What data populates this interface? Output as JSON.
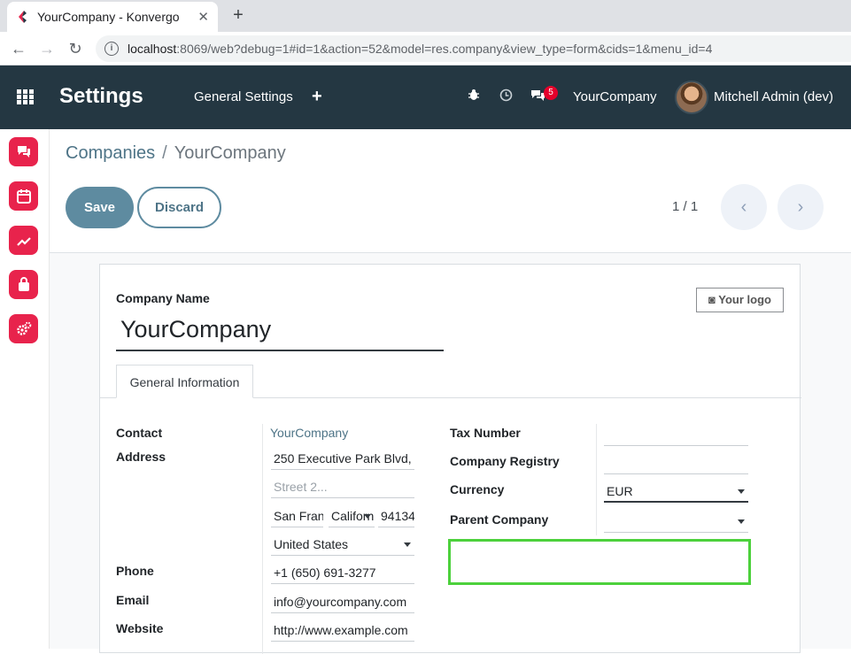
{
  "browser": {
    "tab_title": "YourCompany - Konvergo",
    "url_host": "localhost",
    "url_rest": ":8069/web?debug=1#id=1&action=52&model=res.company&view_type=form&cids=1&menu_id=4"
  },
  "navbar": {
    "app_name": "Settings",
    "menu_general": "General Settings",
    "menu_plus": "+",
    "messages_badge": "5",
    "company": "YourCompany",
    "user": "Mitchell Admin (dev)"
  },
  "rail": {
    "items": [
      "discuss-icon",
      "calendar-icon",
      "dashboard-icon",
      "shopping-bag-icon",
      "settings-gear-icon"
    ]
  },
  "breadcrumb": {
    "parent": "Companies",
    "separator": "/",
    "current": "YourCompany"
  },
  "buttons": {
    "save": "Save",
    "discard": "Discard"
  },
  "pager": {
    "value": "1 / 1"
  },
  "form": {
    "company_name_label": "Company Name",
    "company_name": "YourCompany",
    "logo_button": "Your logo",
    "tab_general": "General Information",
    "left": {
      "contact_label": "Contact",
      "contact_value": "YourCompany",
      "address_label": "Address",
      "street": "250 Executive Park Blvd,",
      "street2_placeholder": "Street 2...",
      "city": "San Francisco",
      "state": "California",
      "zip": "94134",
      "country": "United States",
      "phone_label": "Phone",
      "phone": "+1 (650) 691-3277",
      "email_label": "Email",
      "email": "info@yourcompany.com",
      "website_label": "Website",
      "website": "http://www.example.com"
    },
    "right": {
      "tax_label": "Tax Number",
      "tax_value": "",
      "registry_label": "Company Registry",
      "registry_value": "",
      "currency_label": "Currency",
      "currency_value": "EUR",
      "parent_label": "Parent Company",
      "parent_value": ""
    }
  },
  "colors": {
    "navbar": "#243742",
    "primary": "#5e8ba0",
    "rail_icon": "#e8234c",
    "highlight": "#4cd13c"
  }
}
